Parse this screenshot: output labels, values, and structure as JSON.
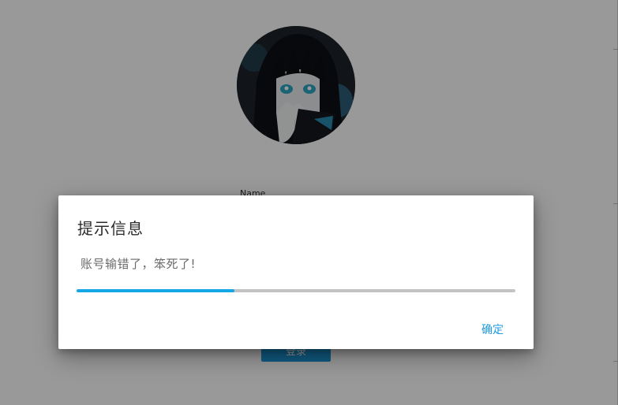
{
  "login_page": {
    "avatar_icon": "anime-character-avatar",
    "name_label": "Name",
    "login_button_label": "登录"
  },
  "dialog": {
    "title": "提示信息",
    "message": "账号输错了，笨死了!",
    "progress": 0.36,
    "confirm_label": "确定"
  },
  "colors": {
    "accent": "#14a6e6",
    "progress_track": "#c3c3c3",
    "login_button": "#1b98d8",
    "overlay": "rgba(0,0,0,0.40)"
  }
}
